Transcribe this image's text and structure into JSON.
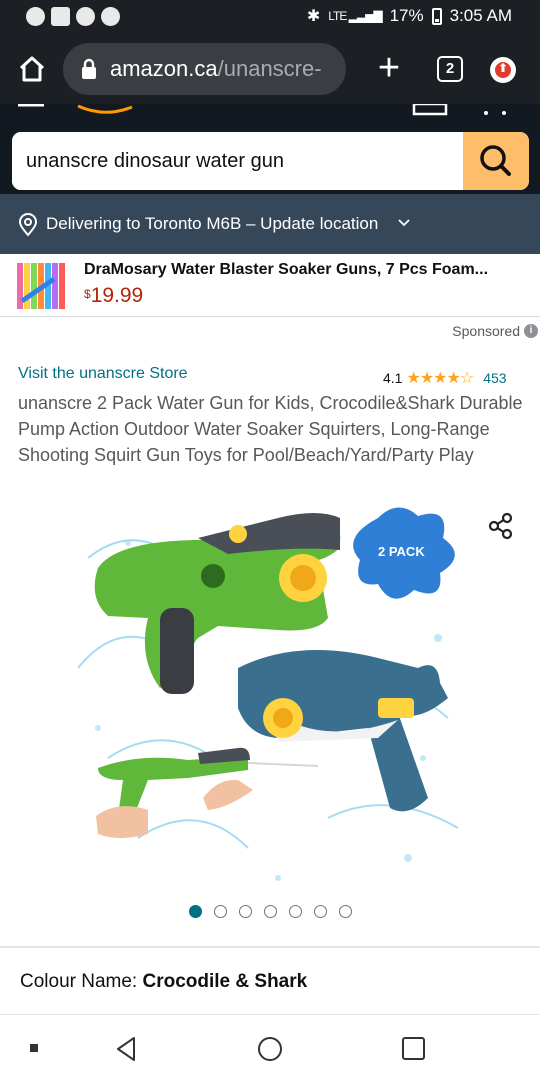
{
  "status_bar": {
    "battery": "17%",
    "time": "3:05 AM",
    "network": "LTE"
  },
  "browser": {
    "url_domain": "amazon.ca",
    "url_path": "/unanscre-",
    "tab_count": "2"
  },
  "search": {
    "value": "unanscre dinosaur water gun"
  },
  "delivery": {
    "text": "Delivering to Toronto M6B – Update location"
  },
  "sponsored_banner": {
    "title": "DraMosary Water Blaster Soaker Guns, 7 Pcs Foam...",
    "currency": "$",
    "price": "19.99"
  },
  "sponsored_label": "Sponsored",
  "product": {
    "store_link": "Visit the unanscre Store",
    "rating": "4.1",
    "stars": "★★★★☆",
    "rating_count": "453",
    "title": "unanscre 2 Pack Water Gun for Kids, Crocodile&Shark Durable Pump Action Outdoor Water Soaker Squirters, Long-Range Shooting Squirt Gun Toys for Pool/Beach/Yard/Party Play",
    "image_badge": "2 PACK",
    "image_count": 7,
    "active_image": 1
  },
  "variant": {
    "label": "Colour Name:",
    "value": "Crocodile & Shark"
  },
  "colors": {
    "amazon_dark": "#131921",
    "delivery_bar": "#37475a",
    "search_button": "#febd69",
    "link": "#007185",
    "price": "#b12704",
    "stars": "#ffa41c"
  }
}
